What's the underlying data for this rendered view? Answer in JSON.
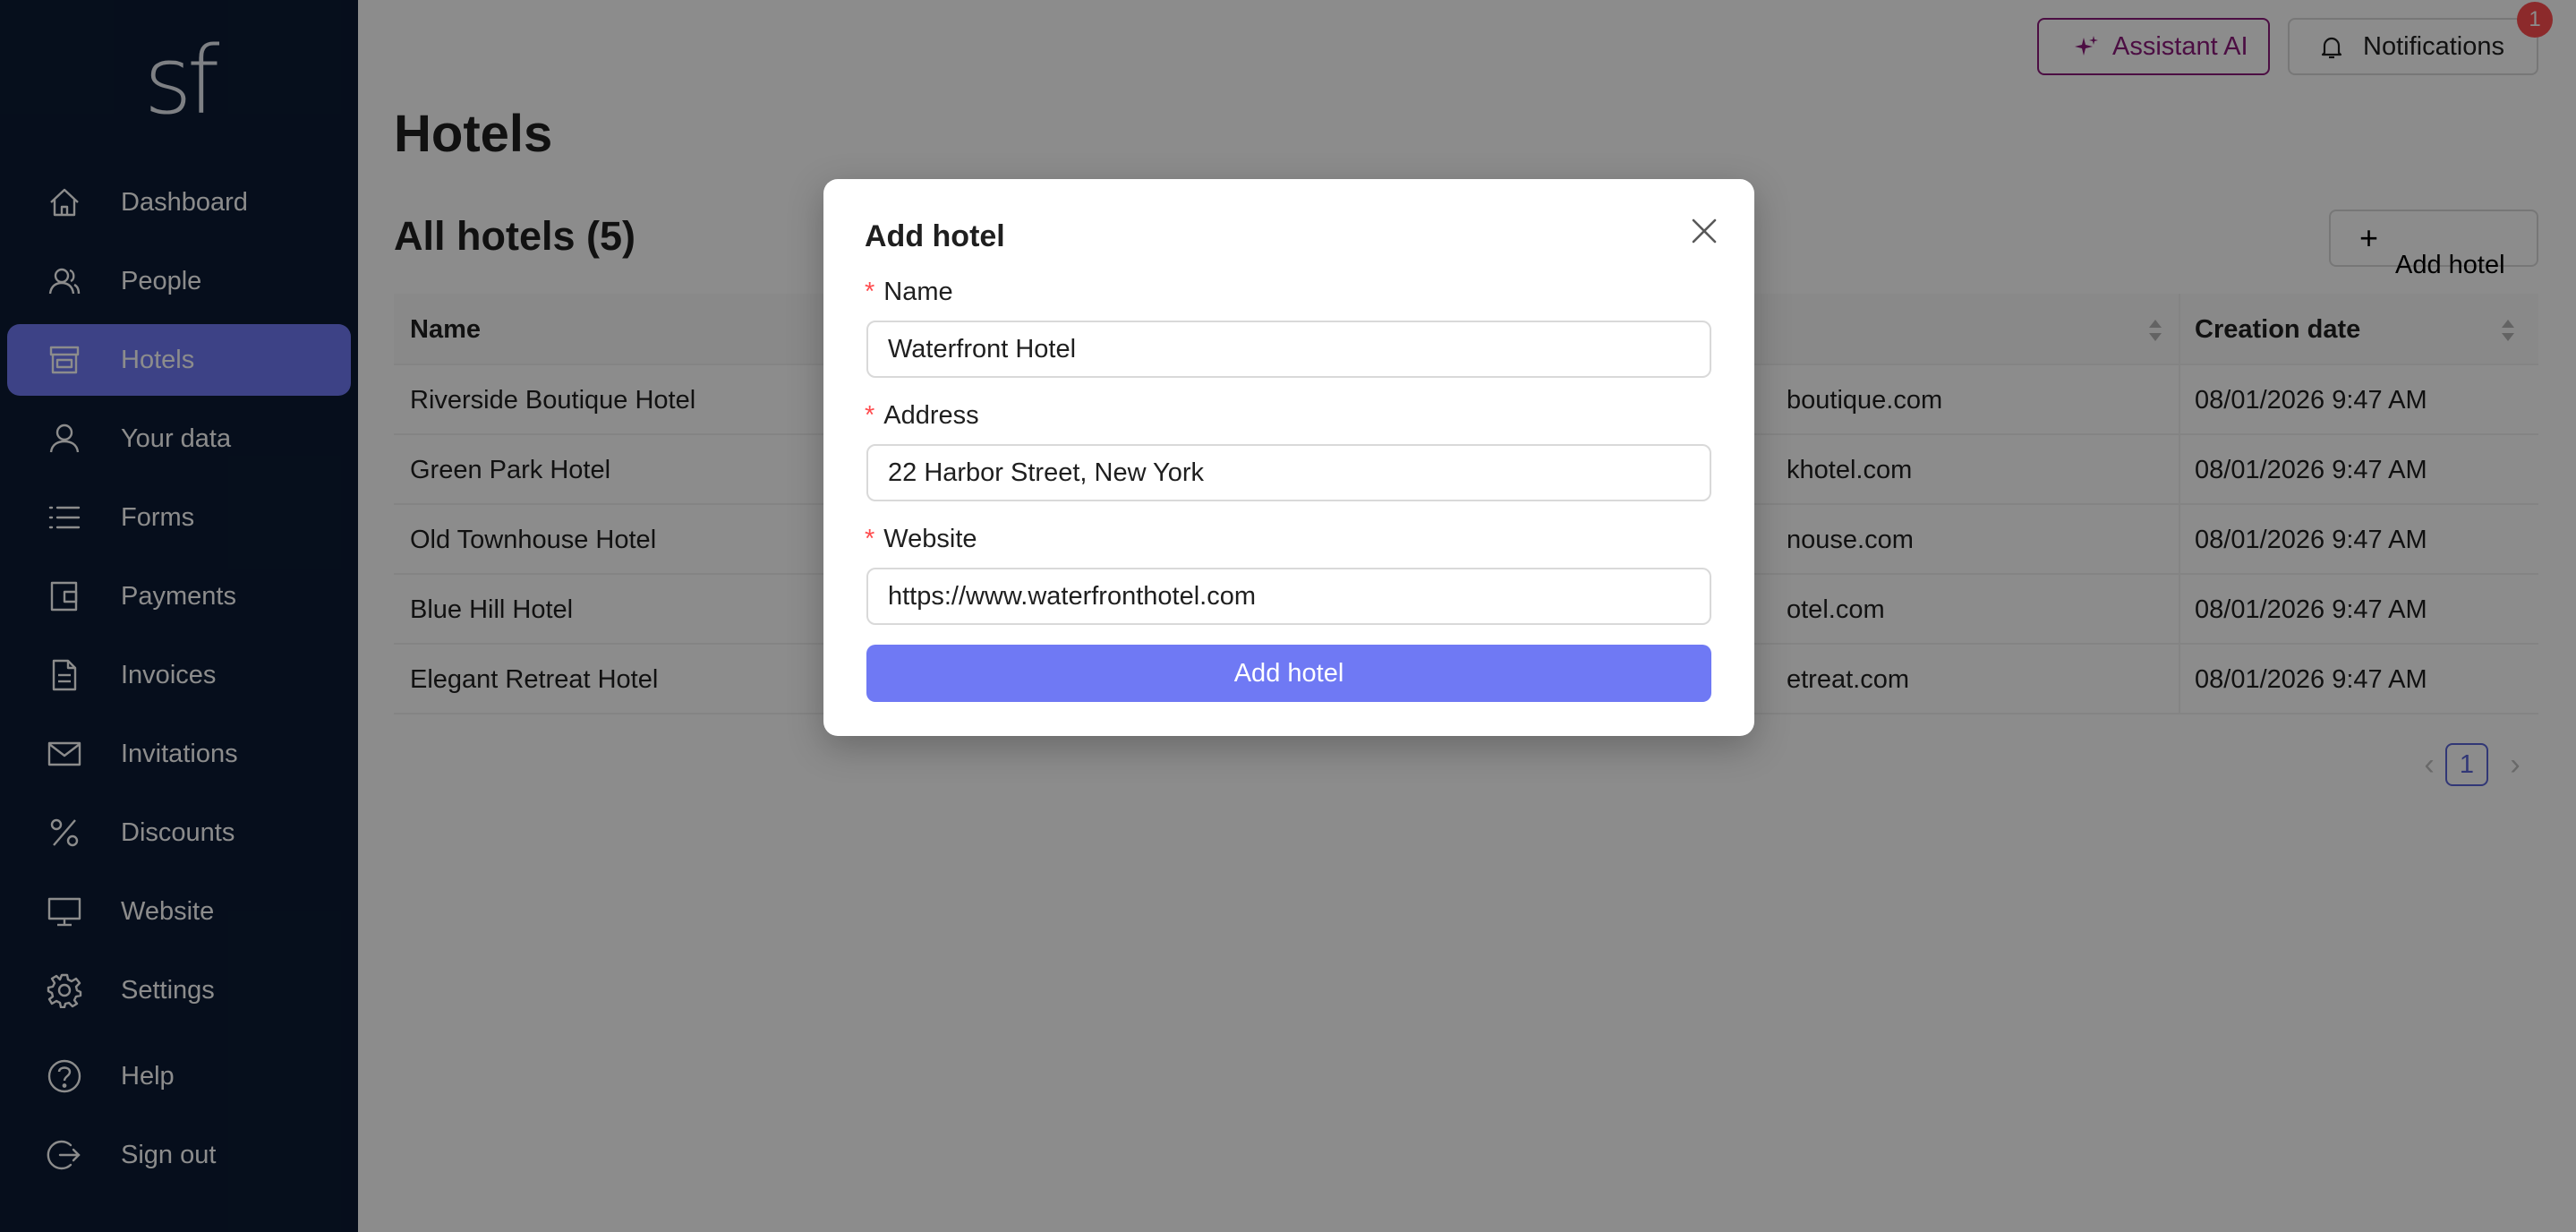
{
  "app": {
    "logo": "sf"
  },
  "sidebar": {
    "items": [
      {
        "label": "Dashboard",
        "icon": "home-icon"
      },
      {
        "label": "People",
        "icon": "users-icon"
      },
      {
        "label": "Hotels",
        "icon": "shop-icon",
        "active": true
      },
      {
        "label": "Your data",
        "icon": "user-icon"
      },
      {
        "label": "Forms",
        "icon": "list-icon"
      },
      {
        "label": "Payments",
        "icon": "wallet-icon"
      },
      {
        "label": "Invoices",
        "icon": "file-icon"
      },
      {
        "label": "Invitations",
        "icon": "mail-icon"
      },
      {
        "label": "Discounts",
        "icon": "percent-icon"
      },
      {
        "label": "Website",
        "icon": "monitor-icon"
      },
      {
        "label": "Settings",
        "icon": "gear-icon"
      },
      {
        "label": "Help",
        "icon": "question-icon"
      },
      {
        "label": "Sign out",
        "icon": "logout-icon"
      }
    ]
  },
  "header": {
    "assistant_label": "Assistant AI",
    "notifications_label": "Notifications",
    "notifications_count": "1"
  },
  "main": {
    "title": "Hotels",
    "section_title": "All hotels (5)",
    "add_button_label": "Add hotel"
  },
  "table": {
    "columns": [
      "Name",
      "",
      "Creation date"
    ],
    "rows": [
      {
        "name": "Riverside Boutique Hotel",
        "website_fragment": "boutique.com",
        "date": "08/01/2026 9:47 AM"
      },
      {
        "name": "Green Park Hotel",
        "website_fragment": "khotel.com",
        "date": "08/01/2026 9:47 AM"
      },
      {
        "name": "Old Townhouse Hotel",
        "website_fragment": "nouse.com",
        "date": "08/01/2026 9:47 AM"
      },
      {
        "name": "Blue Hill Hotel",
        "website_fragment": "otel.com",
        "date": "08/01/2026 9:47 AM"
      },
      {
        "name": "Elegant Retreat Hotel",
        "website_fragment": "etreat.com",
        "date": "08/01/2026 9:47 AM"
      }
    ]
  },
  "pagination": {
    "current": "1",
    "prev": "‹",
    "next": "›"
  },
  "modal": {
    "title": "Add hotel",
    "fields": [
      {
        "label": "Name",
        "value": "Waterfront Hotel"
      },
      {
        "label": "Address",
        "value": "22 Harbor Street, New York"
      },
      {
        "label": "Website",
        "value": "https://www.waterfronthotel.com"
      }
    ],
    "submit_label": "Add hotel",
    "required_mark": "*"
  },
  "colors": {
    "sidebar_bg": "#0b1b33",
    "accent": "#6f79f4",
    "assistant": "#8a1a7a",
    "badge": "#ff4d4f"
  }
}
